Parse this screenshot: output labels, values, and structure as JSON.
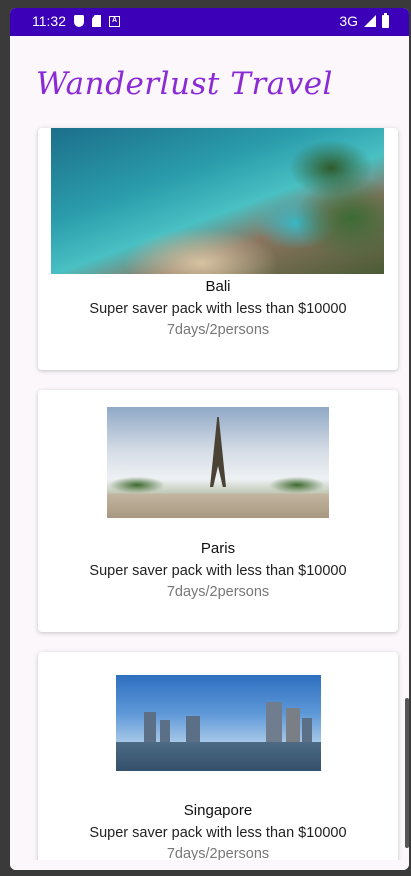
{
  "status_bar": {
    "time": "11:32",
    "network": "3G",
    "left_icons": [
      "shield-icon",
      "sim-card-icon",
      "notification-a-icon"
    ],
    "right_icons": [
      "signal-icon",
      "battery-icon"
    ]
  },
  "app": {
    "title": "Wanderlust Travel",
    "accent_color": "#8a2bd6",
    "status_bar_color": "#3b00b8"
  },
  "packages": [
    {
      "name": "Bali",
      "description": "Super saver pack with less than $10000",
      "duration": "7days/2persons",
      "image": "bali-beach-image"
    },
    {
      "name": "Paris",
      "description": "Super saver pack with less than $10000",
      "duration": "7days/2persons",
      "image": "paris-eiffel-tower-image"
    },
    {
      "name": "Singapore",
      "description": "Super saver pack with less than $10000",
      "duration": "7days/2persons",
      "image": "singapore-skyline-image"
    }
  ]
}
